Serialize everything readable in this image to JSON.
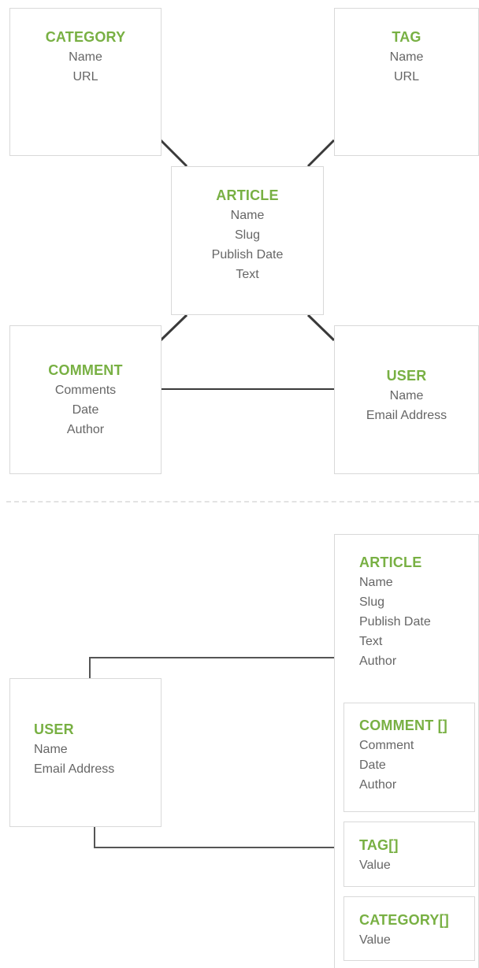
{
  "relational": {
    "category": {
      "title": "CATEGORY",
      "fields": [
        "Name",
        "URL"
      ]
    },
    "tag": {
      "title": "TAG",
      "fields": [
        "Name",
        "URL"
      ]
    },
    "article": {
      "title": "ARTICLE",
      "fields": [
        "Name",
        "Slug",
        "Publish Date",
        "Text"
      ]
    },
    "comment": {
      "title": "COMMENT",
      "fields": [
        "Comments",
        "Date",
        "Author"
      ]
    },
    "user": {
      "title": "USER",
      "fields": [
        "Name",
        "Email Address"
      ]
    }
  },
  "document": {
    "user": {
      "title": "USER",
      "fields": [
        "Name",
        "Email Address"
      ]
    },
    "article": {
      "title": "ARTICLE",
      "fields": [
        "Name",
        "Slug",
        "Publish Date",
        "Text",
        "Author"
      ]
    },
    "comments": {
      "title": "COMMENT []",
      "fields": [
        "Comment",
        "Date",
        "Author"
      ]
    },
    "tags": {
      "title": "TAG[]",
      "fields": [
        "Value"
      ]
    },
    "categories": {
      "title": "CATEGORY[]",
      "fields": [
        "Value"
      ]
    }
  }
}
